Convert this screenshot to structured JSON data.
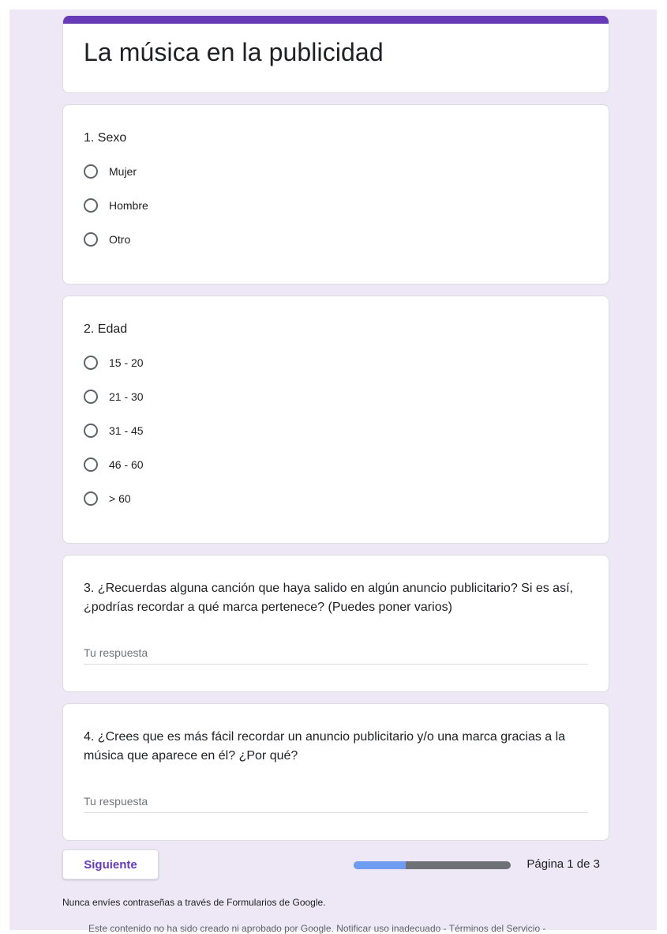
{
  "form": {
    "title": "La música en la publicidad",
    "accent_color": "#673ab7",
    "background_color": "#ede7f6"
  },
  "questions": [
    {
      "title": "1. Sexo",
      "options": [
        "Mujer",
        "Hombre",
        "Otro"
      ]
    },
    {
      "title": "2. Edad",
      "options": [
        "15 - 20",
        "21 - 30",
        "31 - 45",
        "46 - 60",
        "> 60"
      ]
    },
    {
      "title": "3. ¿Recuerdas alguna canción que haya salido en algún anuncio publicitario? Si es así, ¿podrías recordar a qué marca pertenece? (Puedes poner varios)",
      "placeholder": "Tu respuesta"
    },
    {
      "title": "4. ¿Crees que es más fácil recordar un anuncio publicitario y/o una marca gracias a la música que aparece en él? ¿Por qué?",
      "placeholder": "Tu respuesta"
    }
  ],
  "navigation": {
    "next_label": "Siguiente",
    "page_indicator": "Página 1 de 3",
    "progress_fraction": 0.33,
    "progress_fill_color": "#6e9cf0",
    "progress_track_color": "#6e7176"
  },
  "footer": {
    "note": "Nunca envíes contraseñas a través de Formularios de Google.",
    "legal": "Este contenido no ha sido creado ni aprobado por Google. Notificar uso inadecuado - Términos del Servicio -"
  }
}
